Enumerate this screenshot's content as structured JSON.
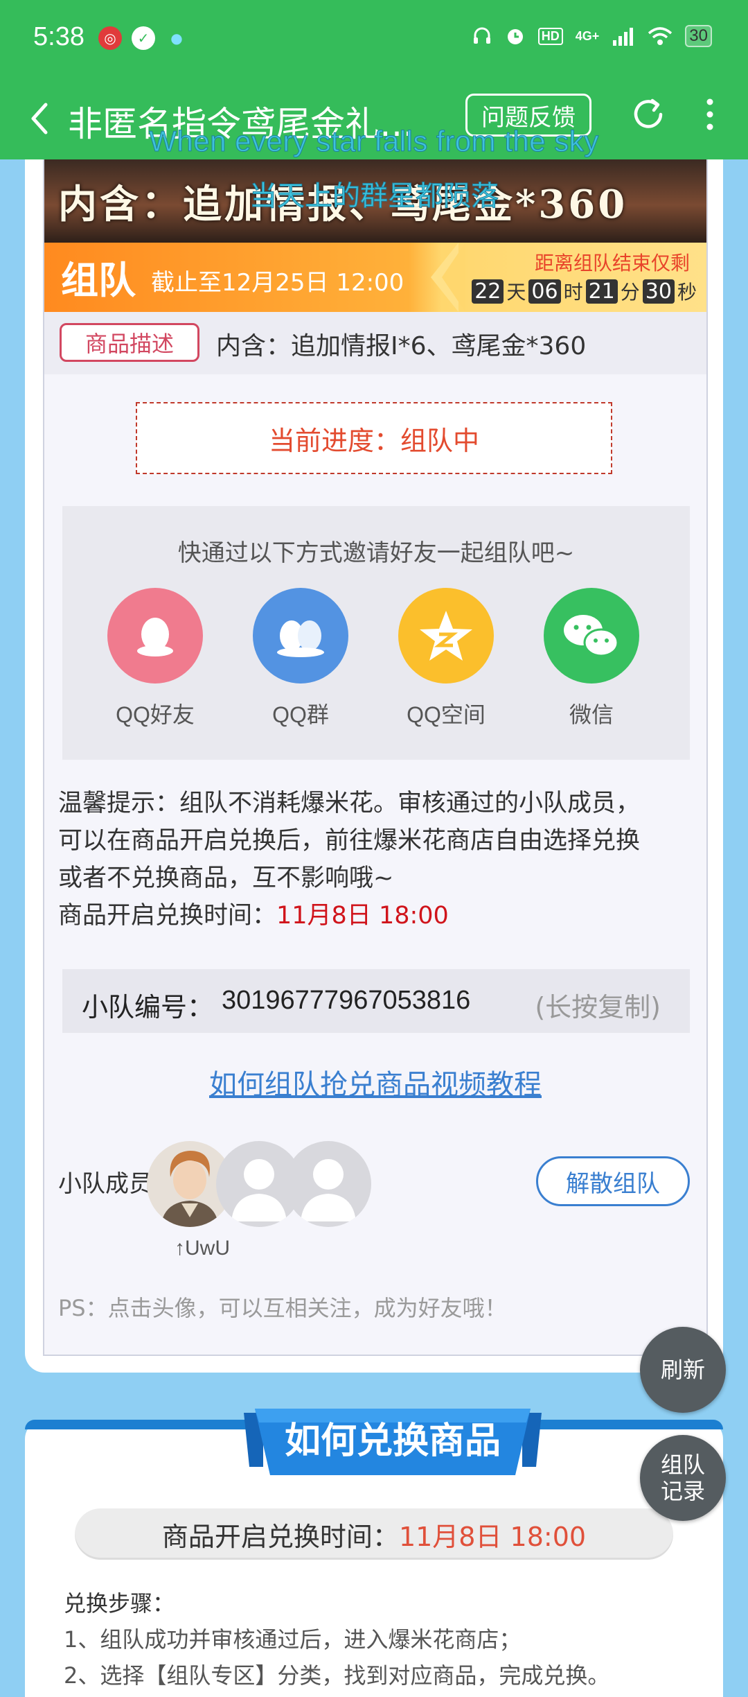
{
  "status_bar": {
    "time": "5:38",
    "network": "4G+",
    "battery": "30",
    "icons": [
      "netease-music-icon",
      "check-icon",
      "qq-icon",
      "headphones-icon",
      "alarm-icon",
      "hd-icon",
      "signal-icon",
      "wifi-icon",
      "battery-icon"
    ]
  },
  "titlebar": {
    "title": "非匿名指令鸢尾金礼…",
    "feedback": "问题反馈"
  },
  "lyrics": {
    "en": "When every star falls from the sky",
    "cn": "当天上的群星都陨落"
  },
  "banner": {
    "text": "内含：追加情报、鸢尾金*360"
  },
  "team": {
    "title": "组队",
    "deadline": "截止至12月25日 12:00",
    "countdown_label": "距离组队结束仅剩",
    "days": "22",
    "days_unit": "天",
    "hours": "06",
    "hours_unit": "时",
    "minutes": "21",
    "minutes_unit": "分",
    "seconds": "30",
    "seconds_unit": "秒"
  },
  "description": {
    "tag": "商品描述",
    "text": "内含：追加情报I*6、鸢尾金*360"
  },
  "progress": "当前进度：组队中",
  "invite": {
    "title": "快通过以下方式邀请好友一起组队吧~",
    "options": [
      {
        "label": "QQ好友",
        "color": "#f07b8e"
      },
      {
        "label": "QQ群",
        "color": "#5393e2"
      },
      {
        "label": "QQ空间",
        "color": "#fbbf2c"
      },
      {
        "label": "微信",
        "color": "#37c060"
      }
    ]
  },
  "tip": {
    "line1": "温馨提示：组队不消耗爆米花。审核通过的小队成员，",
    "line2": "可以在商品开启兑换后，前往爆米花商店自由选择兑换",
    "line3": "或者不兑换商品，互不影响哦~",
    "time_label": "商品开启兑换时间：",
    "time_value": "11月8日 18:00"
  },
  "team_number": {
    "label": "小队编号：",
    "value": "30196777967053816",
    "hint": "(长按复制)"
  },
  "tutorial_link": "如何组队抢兑商品视频教程",
  "members": {
    "label": "小队成员：",
    "first_name": "↑UwU",
    "disband": "解散组队"
  },
  "ps": "PS：点击头像，可以互相关注，成为好友哦！",
  "float_buttons": {
    "refresh": "刷新",
    "record_line1": "组队",
    "record_line2": "记录"
  },
  "redeem": {
    "heading": "如何兑换商品",
    "time_label": "商品开启兑换时间：",
    "time_value": "11月8日 18:00",
    "steps_title": "兑换步骤：",
    "step1": "1、组队成功并审核通过后，进入爆米花商店；",
    "step2": "2、选择【组队专区】分类，找到对应商品，完成兑换。"
  }
}
